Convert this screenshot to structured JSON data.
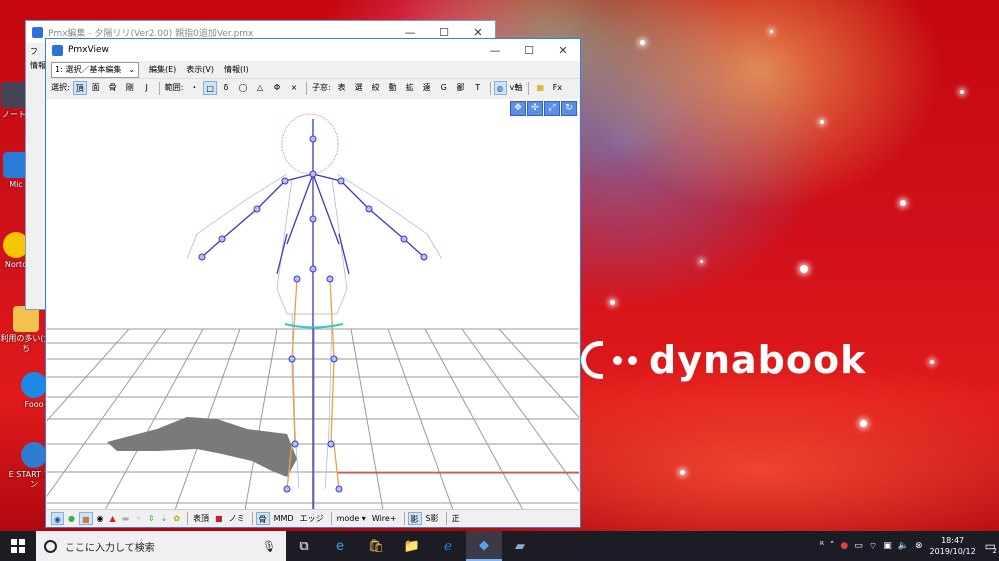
{
  "desktop": {
    "icons": [
      {
        "label": "ノート",
        "icon": "notepad-icon"
      },
      {
        "label": "Mic",
        "icon": "app-icon"
      },
      {
        "label": "Norto",
        "icon": "norton-icon"
      },
      {
        "label": "利用の多い(大ち",
        "icon": "folder-icon"
      },
      {
        "label": "Fooo",
        "icon": "ie-icon"
      },
      {
        "label": "E START アセン",
        "icon": "estart-icon"
      }
    ],
    "brand": "dynabook"
  },
  "back_window": {
    "title": "Pmx編集 - 夕陽リリ(Ver2.00) 親指0追加Ver.pmx",
    "left_labels": [
      "フ",
      "情報"
    ]
  },
  "window": {
    "title": "PmxView",
    "controls": [
      "—",
      "☐",
      "✕"
    ],
    "mode_select": "1: 選択／基本編集",
    "menus": [
      "編集(E)",
      "表示(V)",
      "情報(I)"
    ],
    "toolbar": {
      "select_label": "選択:",
      "select_items": [
        "頂",
        "面",
        "骨",
        "剛",
        "J"
      ],
      "range_label": "範囲:",
      "range_items": [
        "・",
        "□",
        "δ",
        "◯",
        "△",
        "Φ",
        "×"
      ],
      "show_label": "子窓:",
      "show_items": [
        "表",
        "選",
        "絞",
        "動",
        "拡",
        "遠",
        "G",
        "鄙",
        "T"
      ],
      "axis_label": "v軸",
      "fx_label": "Fx"
    },
    "nav_buttons": [
      "move-icon",
      "pan-icon",
      "zoom-icon",
      "rotate-icon"
    ],
    "statusbar": {
      "items": [
        "表頂",
        "ノミ",
        "骨",
        "MMD",
        "エッジ",
        "mode ▾",
        "Wire+",
        "影",
        "S影",
        "正"
      ]
    }
  },
  "taskbar": {
    "search_placeholder": "ここに入力して検索",
    "time": "18:47",
    "date": "2019/10/12",
    "notification_count": "2"
  },
  "colors": {
    "accent": "#0078d7",
    "bone": "#3a3ac0",
    "orange_bone": "#f0a040",
    "cyan": "#30c8c8"
  }
}
